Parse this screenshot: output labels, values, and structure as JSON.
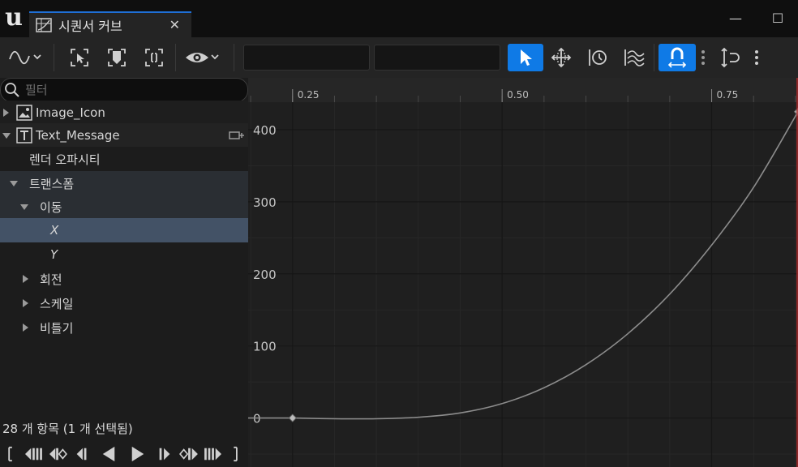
{
  "window": {
    "tab_title": "시퀀서 커브",
    "tab_close": "✕",
    "minimize": "—",
    "maximize": "☐"
  },
  "toolbar": {
    "curve_view_menu": "curve-view",
    "colors": {
      "accent": "#0f7ae6"
    }
  },
  "filter": {
    "placeholder": "필터"
  },
  "tree": {
    "items": [
      {
        "label": "Image_Icon"
      },
      {
        "label": "Text_Message"
      },
      {
        "label": "렌더 오파시티"
      },
      {
        "label": "트랜스폼"
      },
      {
        "label": "이동"
      },
      {
        "label": "X"
      },
      {
        "label": "Y"
      },
      {
        "label": "회전"
      },
      {
        "label": "스케일"
      },
      {
        "label": "비틀기"
      }
    ]
  },
  "status": {
    "item_count": "28 개 항목 (1 개 선택됨)"
  },
  "chart_data": {
    "type": "line",
    "x_ticks": [
      "0.25",
      "0.50",
      "0.75"
    ],
    "y_ticks": [
      "0",
      "100",
      "200",
      "300",
      "400"
    ],
    "xlim": [
      0.197,
      0.853
    ],
    "ylim": [
      -68,
      472
    ],
    "series": [
      {
        "x": [
          0.25,
          0.3,
          0.35,
          0.4,
          0.45,
          0.5,
          0.55,
          0.6,
          0.65,
          0.7,
          0.75,
          0.8,
          0.853
        ],
        "y": [
          0,
          -1,
          -1,
          1,
          7,
          20,
          42,
          74,
          117,
          172,
          240,
          320,
          425
        ]
      }
    ],
    "keyframes": [
      {
        "x": 0.25,
        "y": 0
      },
      {
        "x": 0.853,
        "y": 425
      }
    ]
  }
}
